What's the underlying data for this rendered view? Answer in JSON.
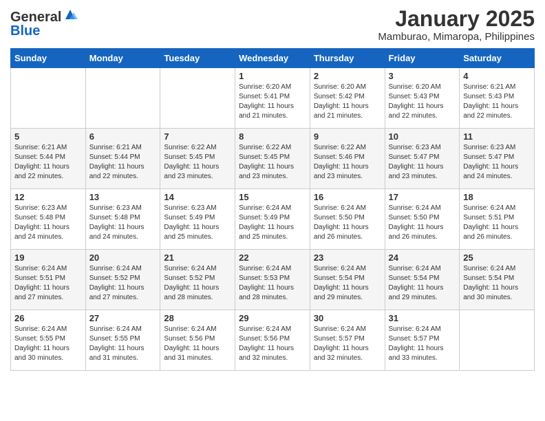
{
  "header": {
    "logo_general": "General",
    "logo_blue": "Blue",
    "title": "January 2025",
    "subtitle": "Mamburao, Mimaropa, Philippines"
  },
  "calendar": {
    "days_of_week": [
      "Sunday",
      "Monday",
      "Tuesday",
      "Wednesday",
      "Thursday",
      "Friday",
      "Saturday"
    ],
    "weeks": [
      [
        {
          "day": "",
          "info": ""
        },
        {
          "day": "",
          "info": ""
        },
        {
          "day": "",
          "info": ""
        },
        {
          "day": "1",
          "info": "Sunrise: 6:20 AM\nSunset: 5:41 PM\nDaylight: 11 hours and 21 minutes."
        },
        {
          "day": "2",
          "info": "Sunrise: 6:20 AM\nSunset: 5:42 PM\nDaylight: 11 hours and 21 minutes."
        },
        {
          "day": "3",
          "info": "Sunrise: 6:20 AM\nSunset: 5:43 PM\nDaylight: 11 hours and 22 minutes."
        },
        {
          "day": "4",
          "info": "Sunrise: 6:21 AM\nSunset: 5:43 PM\nDaylight: 11 hours and 22 minutes."
        }
      ],
      [
        {
          "day": "5",
          "info": "Sunrise: 6:21 AM\nSunset: 5:44 PM\nDaylight: 11 hours and 22 minutes."
        },
        {
          "day": "6",
          "info": "Sunrise: 6:21 AM\nSunset: 5:44 PM\nDaylight: 11 hours and 22 minutes."
        },
        {
          "day": "7",
          "info": "Sunrise: 6:22 AM\nSunset: 5:45 PM\nDaylight: 11 hours and 23 minutes."
        },
        {
          "day": "8",
          "info": "Sunrise: 6:22 AM\nSunset: 5:45 PM\nDaylight: 11 hours and 23 minutes."
        },
        {
          "day": "9",
          "info": "Sunrise: 6:22 AM\nSunset: 5:46 PM\nDaylight: 11 hours and 23 minutes."
        },
        {
          "day": "10",
          "info": "Sunrise: 6:23 AM\nSunset: 5:47 PM\nDaylight: 11 hours and 23 minutes."
        },
        {
          "day": "11",
          "info": "Sunrise: 6:23 AM\nSunset: 5:47 PM\nDaylight: 11 hours and 24 minutes."
        }
      ],
      [
        {
          "day": "12",
          "info": "Sunrise: 6:23 AM\nSunset: 5:48 PM\nDaylight: 11 hours and 24 minutes."
        },
        {
          "day": "13",
          "info": "Sunrise: 6:23 AM\nSunset: 5:48 PM\nDaylight: 11 hours and 24 minutes."
        },
        {
          "day": "14",
          "info": "Sunrise: 6:23 AM\nSunset: 5:49 PM\nDaylight: 11 hours and 25 minutes."
        },
        {
          "day": "15",
          "info": "Sunrise: 6:24 AM\nSunset: 5:49 PM\nDaylight: 11 hours and 25 minutes."
        },
        {
          "day": "16",
          "info": "Sunrise: 6:24 AM\nSunset: 5:50 PM\nDaylight: 11 hours and 26 minutes."
        },
        {
          "day": "17",
          "info": "Sunrise: 6:24 AM\nSunset: 5:50 PM\nDaylight: 11 hours and 26 minutes."
        },
        {
          "day": "18",
          "info": "Sunrise: 6:24 AM\nSunset: 5:51 PM\nDaylight: 11 hours and 26 minutes."
        }
      ],
      [
        {
          "day": "19",
          "info": "Sunrise: 6:24 AM\nSunset: 5:51 PM\nDaylight: 11 hours and 27 minutes."
        },
        {
          "day": "20",
          "info": "Sunrise: 6:24 AM\nSunset: 5:52 PM\nDaylight: 11 hours and 27 minutes."
        },
        {
          "day": "21",
          "info": "Sunrise: 6:24 AM\nSunset: 5:52 PM\nDaylight: 11 hours and 28 minutes."
        },
        {
          "day": "22",
          "info": "Sunrise: 6:24 AM\nSunset: 5:53 PM\nDaylight: 11 hours and 28 minutes."
        },
        {
          "day": "23",
          "info": "Sunrise: 6:24 AM\nSunset: 5:54 PM\nDaylight: 11 hours and 29 minutes."
        },
        {
          "day": "24",
          "info": "Sunrise: 6:24 AM\nSunset: 5:54 PM\nDaylight: 11 hours and 29 minutes."
        },
        {
          "day": "25",
          "info": "Sunrise: 6:24 AM\nSunset: 5:54 PM\nDaylight: 11 hours and 30 minutes."
        }
      ],
      [
        {
          "day": "26",
          "info": "Sunrise: 6:24 AM\nSunset: 5:55 PM\nDaylight: 11 hours and 30 minutes."
        },
        {
          "day": "27",
          "info": "Sunrise: 6:24 AM\nSunset: 5:55 PM\nDaylight: 11 hours and 31 minutes."
        },
        {
          "day": "28",
          "info": "Sunrise: 6:24 AM\nSunset: 5:56 PM\nDaylight: 11 hours and 31 minutes."
        },
        {
          "day": "29",
          "info": "Sunrise: 6:24 AM\nSunset: 5:56 PM\nDaylight: 11 hours and 32 minutes."
        },
        {
          "day": "30",
          "info": "Sunrise: 6:24 AM\nSunset: 5:57 PM\nDaylight: 11 hours and 32 minutes."
        },
        {
          "day": "31",
          "info": "Sunrise: 6:24 AM\nSunset: 5:57 PM\nDaylight: 11 hours and 33 minutes."
        },
        {
          "day": "",
          "info": ""
        }
      ]
    ]
  }
}
